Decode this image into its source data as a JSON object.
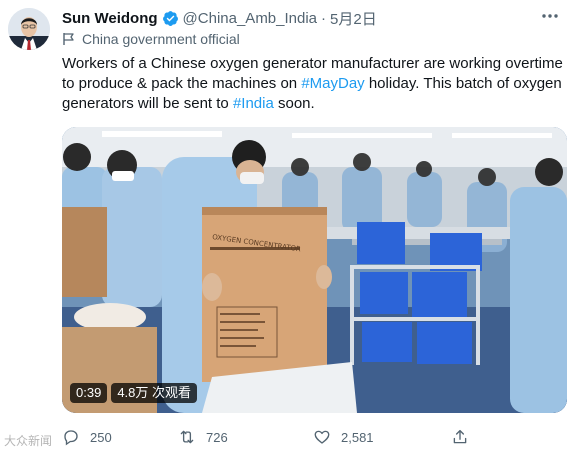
{
  "user": {
    "name": "Sun Weidong",
    "handle": "@China_Amb_India",
    "separator": "·",
    "date": "5月2日"
  },
  "label": {
    "text": "China government official",
    "icon": "flag-icon"
  },
  "tweet": {
    "text_part1": "Workers of a Chinese oxygen generator manufacturer are working overtime to produce & pack the machines on ",
    "hashtag1": "#MayDay",
    "text_part2": " holiday. This batch of oxygen generators will be sent to ",
    "hashtag2": "#India",
    "text_part3": " soon."
  },
  "video": {
    "duration": "0:39",
    "views": "4.8万 次观看",
    "box_label": "OXYGEN CONCENTRATOR"
  },
  "actions": {
    "reply_count": "250",
    "retweet_count": "726",
    "like_count": "2,581"
  },
  "watermark": {
    "text": "大众新闻"
  },
  "colors": {
    "accent": "#1d9bf0",
    "secondary_text": "#536471",
    "primary_text": "#0f1419"
  }
}
